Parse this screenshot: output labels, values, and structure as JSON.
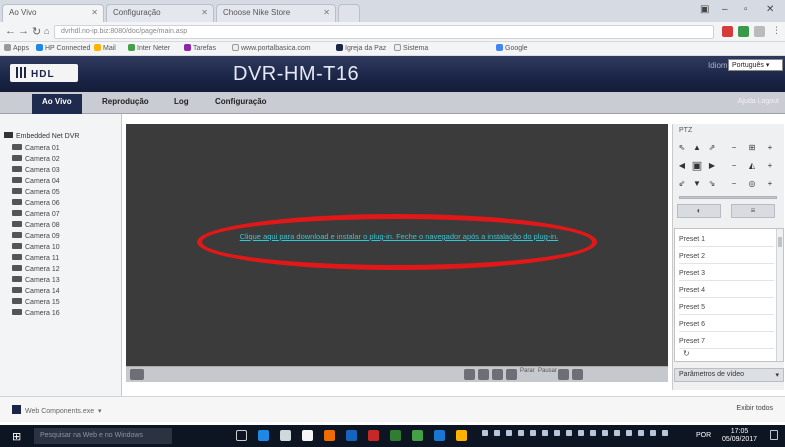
{
  "browser": {
    "tabs": [
      "Ao Vivo",
      "Configuração",
      "Choose Nike Store"
    ],
    "address": "dvrhdl.no-ip.biz:8080/doc/page/main.asp",
    "bookmarks": [
      "Apps",
      "HP Connected",
      "Mail",
      "Inter Neter",
      "Tarefas",
      "www.portalbasica.com",
      "Igreja da Paz",
      "Sistema",
      "Google"
    ],
    "downloads": {
      "item": "Web Components.exe",
      "show_all": "Exibir todos"
    }
  },
  "app": {
    "logo": "HDL",
    "title": "DVR-HM-T16",
    "user": "Idioma",
    "language": "Português",
    "nav": {
      "tabs": [
        "Ao Vivo",
        "Reprodução",
        "Log",
        "Configuração"
      ],
      "right": "Ajuda   Logout"
    },
    "device": "Embedded Net DVR",
    "cameras": [
      "Camera 01",
      "Camera 02",
      "Camera 03",
      "Camera 04",
      "Camera 05",
      "Camera 06",
      "Camera 07",
      "Camera 08",
      "Camera 09",
      "Camera 10",
      "Camera 11",
      "Camera 12",
      "Camera 13",
      "Camera 14",
      "Camera 15",
      "Camera 16"
    ],
    "plugin_message": "Clique aqui para download e instalar o plug-in. Feche o navegador após a instalação do plug-in.",
    "ptz": {
      "title": "PTZ",
      "presets": [
        "Preset 1",
        "Preset 2",
        "Preset 3",
        "Preset 4",
        "Preset 5",
        "Preset 6",
        "Preset 7"
      ],
      "video_params": "Parâmetros de vídeo"
    },
    "toolbar": {
      "labels": [
        "Parar",
        "Pausar"
      ]
    }
  },
  "taskbar": {
    "search_placeholder": "Pesquisar na Web e no Windows",
    "time": "17:05",
    "date": "05/09/2017",
    "lang": "POR"
  }
}
